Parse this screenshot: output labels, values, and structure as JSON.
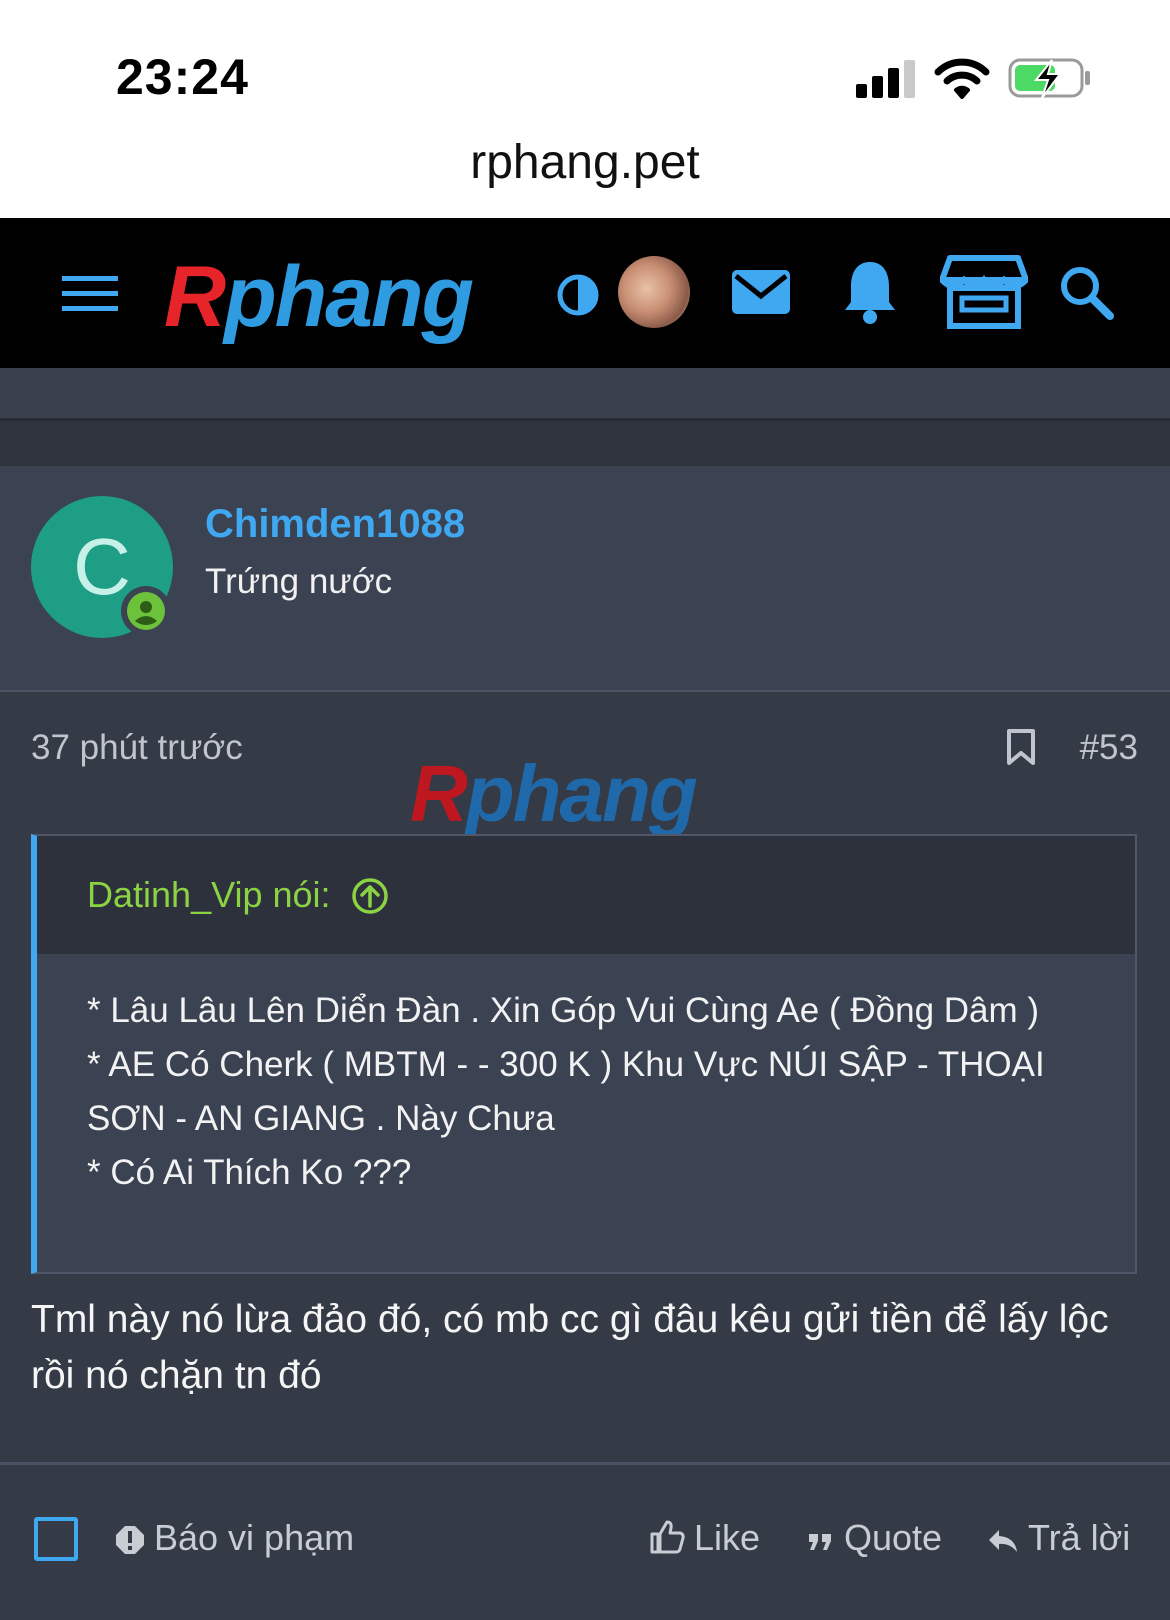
{
  "status_bar": {
    "time": "23:24"
  },
  "browser": {
    "url": "rphang.pet"
  },
  "header": {
    "logo_r": "R",
    "logo_rest": "phang"
  },
  "user": {
    "initial": "C",
    "name": "Chimden1088",
    "title": "Trứng nước"
  },
  "post": {
    "time": "37 phút trước",
    "number": "#53",
    "watermark_r": "R",
    "watermark_rest": "phang",
    "quote": {
      "author": "Datinh_Vip nói:",
      "lines": [
        "* Lâu Lâu Lên Diển Đàn . Xin Góp Vui Cùng Ae ( Đồng Dâm )",
        "* AE Có Cherk ( MBTM - - 300 K ) Khu Vực NÚI SẬP - THOẠI SƠN - AN GIANG . Này Chưa",
        "* Có Ai Thích Ko ???"
      ]
    },
    "reply": "Tml này nó lừa đảo đó, có mb cc gì đâu kêu gửi tiền để lấy lộc rồi nó chặn tn đó"
  },
  "actions": {
    "report": "Báo vi phạm",
    "like": "Like",
    "quote": "Quote",
    "reply": "Trả lời"
  },
  "colors": {
    "accent": "#3fa8f0",
    "online": "#6cc23a",
    "quote_author": "#8bd343",
    "background": "#343a46"
  }
}
